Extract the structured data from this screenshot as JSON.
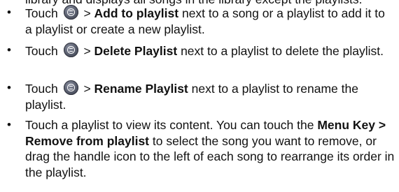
{
  "top_partial_text": "library and displays all songs in the library except the playlists.",
  "items": [
    {
      "touch": "Touch",
      "sep": " > ",
      "bold": "Add to playlist",
      "rest": " next to a song or a playlist to add it to a playlist or create a new playlist."
    },
    {
      "touch": "Touch",
      "sep": " > ",
      "bold": "Delete Playlist",
      "rest": " next to a playlist to delete the playlist."
    },
    {
      "touch": "Touch",
      "sep": " > ",
      "bold": "Rename Playlist",
      "rest": " next to a playlist to rename the playlist."
    },
    {
      "text_before": "Touch a playlist to view its content. You can touch the ",
      "bold": "Menu Key > Remove from playlist",
      "text_after": " to select the song you want to remove, or drag the handle icon to the left of each song to rearrange its order in the playlist."
    }
  ],
  "icons": {
    "menu": "menu-icon"
  },
  "bullet_char": "•"
}
